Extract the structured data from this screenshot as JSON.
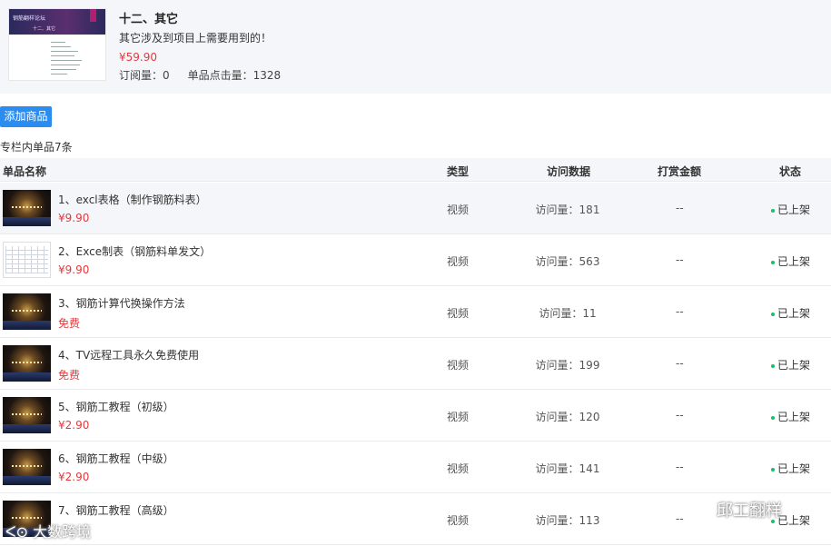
{
  "column": {
    "title": "十二、其它",
    "description": "其它涉及到项目上需要用到的！",
    "price": "¥59.90",
    "subscriptions": "订阅量：0",
    "clicks": "单品点击量：1328",
    "cover": {
      "banner_title": "钢筋翻样论坛",
      "banner_sub": "十二、其它"
    }
  },
  "toolbar": {
    "add_label": "添加商品"
  },
  "summary": "专栏内单品7条",
  "table": {
    "headers": {
      "name": "单品名称",
      "type": "类型",
      "visits": "访问数据",
      "tip": "打赏金额",
      "status": "状态"
    },
    "rows": [
      {
        "title": "1、excl表格（制作钢筋料表）",
        "price": "¥9.90",
        "type": "视频",
        "visits": "访问量：181",
        "tip": "--",
        "status": "已上架",
        "thumb": "stage"
      },
      {
        "title": "2、Exce制表（钢筋料单发文）",
        "price": "¥9.90",
        "type": "视频",
        "visits": "访问量：563",
        "tip": "--",
        "status": "已上架",
        "thumb": "sheet"
      },
      {
        "title": "3、钢筋计算代换操作方法",
        "price": "免费",
        "type": "视频",
        "visits": "访问量：11",
        "tip": "--",
        "status": "已上架",
        "thumb": "stage"
      },
      {
        "title": "4、TV远程工具永久免费使用",
        "price": "免费",
        "type": "视频",
        "visits": "访问量：199",
        "tip": "--",
        "status": "已上架",
        "thumb": "stage"
      },
      {
        "title": "5、钢筋工教程（初级）",
        "price": "¥2.90",
        "type": "视频",
        "visits": "访问量：120",
        "tip": "--",
        "status": "已上架",
        "thumb": "stage"
      },
      {
        "title": "6、钢筋工教程（中级）",
        "price": "¥2.90",
        "type": "视频",
        "visits": "访问量：141",
        "tip": "--",
        "status": "已上架",
        "thumb": "stage"
      },
      {
        "title": "7、钢筋工教程（高级）",
        "price": "",
        "type": "视频",
        "visits": "访问量：113",
        "tip": "--",
        "status": "已上架",
        "thumb": "stage"
      }
    ]
  },
  "watermarks": {
    "right": "邱工翻样",
    "left": "大数跨境"
  },
  "colors": {
    "accent": "#2d8cf0",
    "price": "#e4393c",
    "status_dot": "#19be6b"
  }
}
